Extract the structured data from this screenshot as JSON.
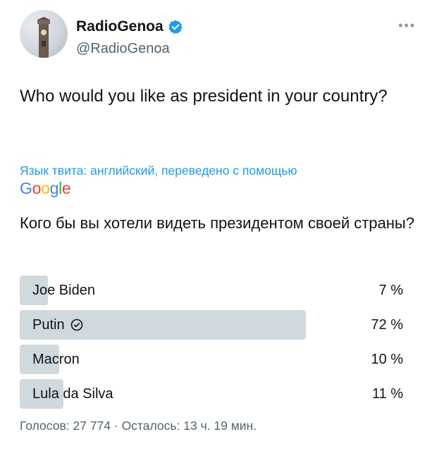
{
  "author": {
    "display_name": "RadioGenoa",
    "handle": "@RadioGenoa",
    "verified_color": "#1d9bf0"
  },
  "tweet": {
    "text": "Who would you like as president in your country?"
  },
  "translation": {
    "note": "Язык твита: английский, переведено с помощью",
    "provider": "Google",
    "text": "Кого бы вы хотели видеть президентом своей страны?"
  },
  "poll": {
    "options": [
      {
        "label": "Joe Biden",
        "percent_text": "7 %",
        "share": 0.07,
        "winner": false
      },
      {
        "label": "Putin",
        "percent_text": "72 %",
        "share": 0.72,
        "winner": true
      },
      {
        "label": "Macron",
        "percent_text": "10 %",
        "share": 0.1,
        "winner": false
      },
      {
        "label": "Lula da Silva",
        "percent_text": "11 %",
        "share": 0.11,
        "winner": false
      }
    ],
    "footer": "Голосов: 27 774 · Осталось: 13 ч. 19 мин."
  },
  "icons": {
    "more": "more-options-icon",
    "verified": "verified-badge-icon",
    "winner": "check-circle-icon"
  }
}
